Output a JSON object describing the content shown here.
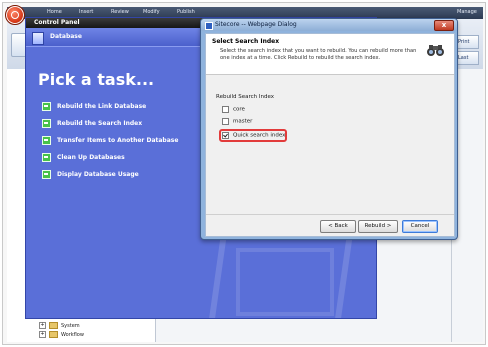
{
  "app": {
    "ribbon_tabs": [
      "Home",
      "Insert",
      "Review",
      "Modify",
      "Publish",
      "Manage"
    ],
    "right_buttons": [
      "Print",
      "Last"
    ]
  },
  "control_panel": {
    "title": "Control Panel",
    "header": "Database",
    "pick_task": "Pick a task...",
    "tasks": [
      "Rebuild the Link Database",
      "Rebuild the Search Index",
      "Transfer Items to Another Database",
      "Clean Up Databases",
      "Display Database Usage"
    ]
  },
  "tree": {
    "items": [
      "System",
      "Workflow"
    ]
  },
  "dialog": {
    "title": "Sitecore -- Webpage Dialog",
    "section_title": "Select Search Index",
    "description": "Select the search index that you want to rebuild. You can rebuild more than one index at a time. Click Rebuild to rebuild the search index.",
    "group_label": "Rebuild Search Index",
    "options": [
      {
        "label": "core",
        "checked": false
      },
      {
        "label": "master",
        "checked": false
      },
      {
        "label": "Quick search index",
        "checked": true
      }
    ],
    "buttons": {
      "back": "< Back",
      "rebuild": "Rebuild >",
      "cancel": "Cancel"
    },
    "close_symbol": "x"
  }
}
